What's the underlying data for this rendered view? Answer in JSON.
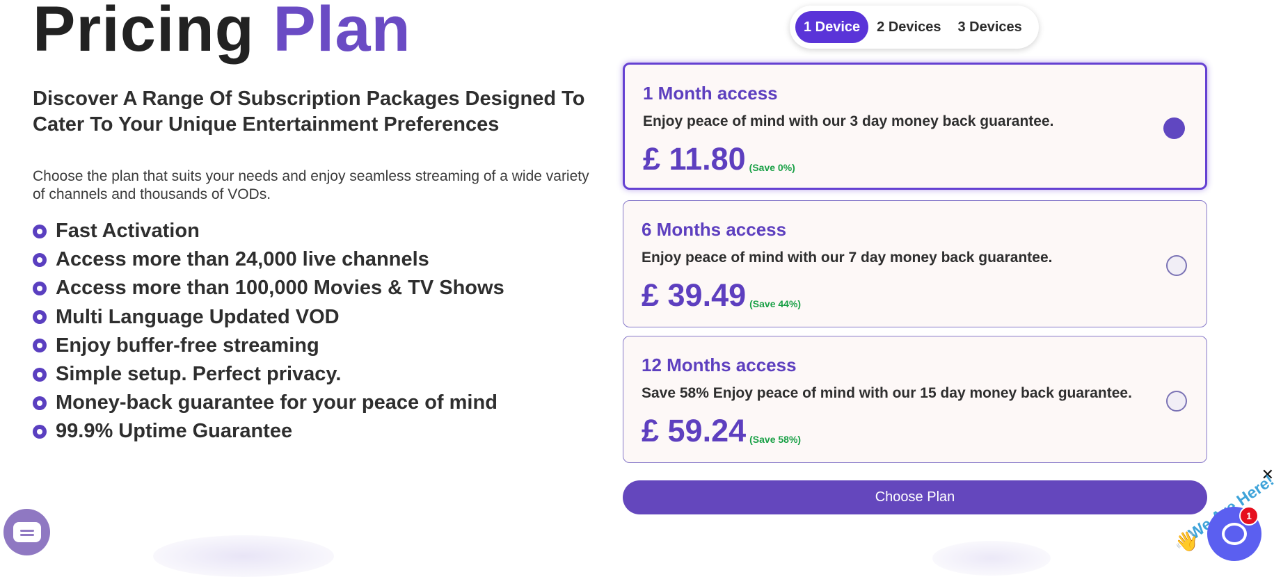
{
  "header": {
    "title_part1": "Pricing",
    "title_part2": "Plan"
  },
  "intro": {
    "subtitle": "Discover A Range Of Subscription Packages Designed To Cater To Your Unique Entertainment Preferences",
    "description": "Choose the plan that suits your needs and enjoy seamless streaming of a wide variety of channels and thousands of VODs."
  },
  "features": [
    "Fast Activation",
    "Access more than 24,000 live channels",
    "Access more than 100,000 Movies & TV Shows",
    "Multi Language Updated VOD",
    "Enjoy buffer-free streaming",
    "Simple setup. Perfect privacy.",
    "Money-back guarantee for your peace of mind",
    "99.9% Uptime Guarantee"
  ],
  "device_toggle": {
    "options": [
      "1 Device",
      "2 Devices",
      "3 Devices"
    ],
    "selected": "1 Device"
  },
  "plans": [
    {
      "name": "1 Month access",
      "description": "Enjoy peace of mind with our 3 day money back guarantee.",
      "price": "£ 11.80",
      "save": "(Save 0%)",
      "selected": true
    },
    {
      "name": "6 Months access",
      "description": "Enjoy peace of mind with our 7 day money back guarantee.",
      "price": "£ 39.49",
      "save": "(Save 44%)",
      "selected": false
    },
    {
      "name": "12 Months access",
      "description": "Save 58% Enjoy peace of mind with our 15 day money back guarantee.",
      "price": "£ 59.24",
      "save": "(Save 58%)",
      "selected": false
    }
  ],
  "cta": {
    "label": "Choose Plan"
  },
  "chat_widget": {
    "tagline": "We Are Here!",
    "badge_count": "1",
    "close_glyph": "✕"
  },
  "colors": {
    "accent": "#5d3fbf",
    "toggle_active": "#5a34d8",
    "button": "#6447bd",
    "save_green": "#19a046",
    "plan_bg": "#fdf8f7"
  },
  "icons": [
    "bullet-circle-icon",
    "radio-icon",
    "chat-bubble-icon",
    "waving-hand-icon",
    "close-icon"
  ]
}
